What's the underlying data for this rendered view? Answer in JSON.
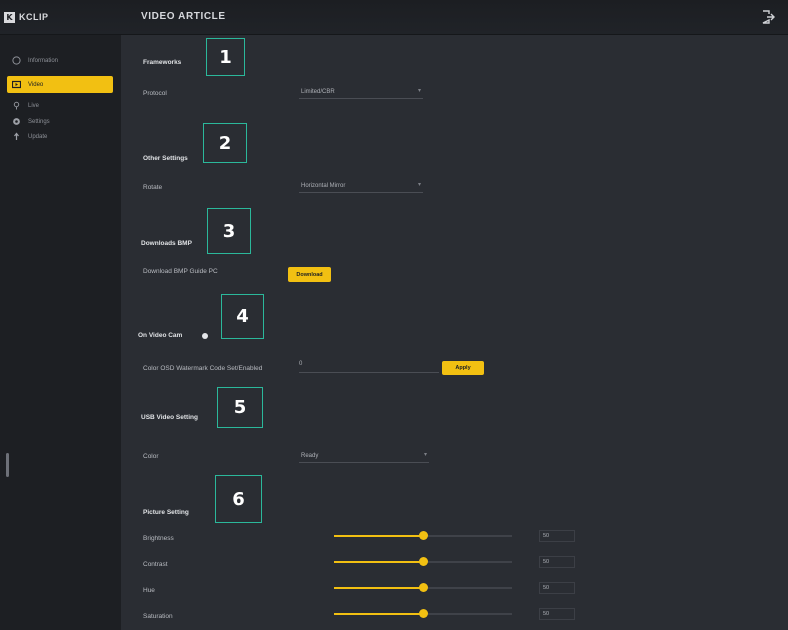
{
  "header": {
    "logo_mark": "K",
    "logo_text": "KCLIP",
    "page_title": "VIDEO ARTICLE"
  },
  "sidebar": {
    "items": [
      {
        "label": "Information",
        "icon": "info-icon"
      },
      {
        "label": "Video",
        "icon": "video-icon",
        "active": true
      },
      {
        "label": "Live",
        "icon": "live-icon"
      },
      {
        "label": "Settings",
        "icon": "gear-icon"
      },
      {
        "label": "Update",
        "icon": "update-icon"
      }
    ]
  },
  "sections": {
    "s1": {
      "callout": "1",
      "title": "Frameworks",
      "field_label": "Protocol",
      "select_value": "Limited/CBR"
    },
    "s2": {
      "callout": "2",
      "title": "Other Settings",
      "field_label": "Rotate",
      "select_value": "Horizontal Mirror"
    },
    "s3": {
      "callout": "3",
      "title": "Downloads BMP",
      "field_label": "Download BMP Guide PC",
      "button_label": "Download"
    },
    "s4": {
      "callout": "4",
      "title": "On Video Cam",
      "field_label": "Color OSD Watermark Code Set/Enabled",
      "input_value": "0",
      "button_label": "Apply"
    },
    "s5": {
      "callout": "5",
      "title": "USB Video Setting",
      "field_label": "Color",
      "select_value": "Ready"
    },
    "s6": {
      "callout": "6",
      "title": "Picture Setting"
    }
  },
  "sliders": [
    {
      "label": "Brightness",
      "value": 50
    },
    {
      "label": "Contrast",
      "value": 50
    },
    {
      "label": "Hue",
      "value": 50
    },
    {
      "label": "Saturation",
      "value": 50
    }
  ],
  "colors": {
    "accent": "#f2c012",
    "background": "#2a2d33",
    "sidebar": "#1d1f23",
    "callout_border": "#2bb89b"
  }
}
